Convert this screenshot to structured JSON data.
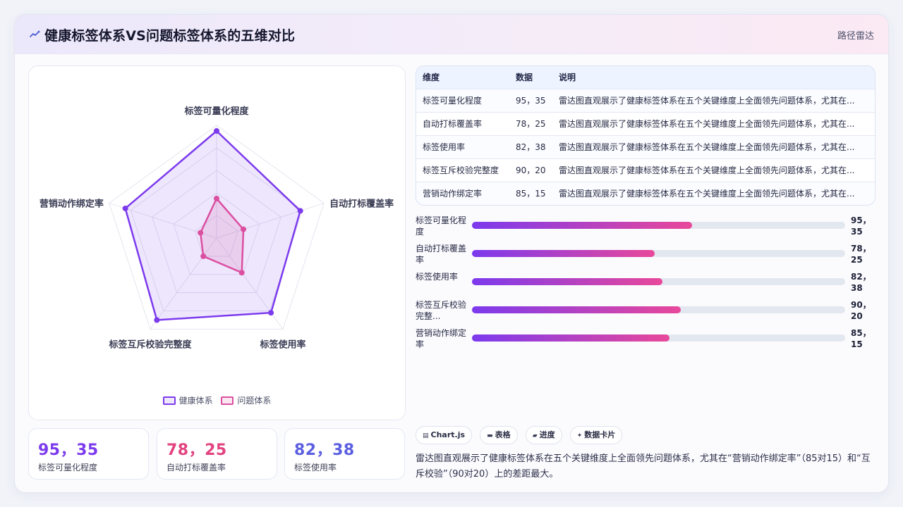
{
  "header": {
    "title": "健康标签体系VS问题标签体系的五维对比",
    "badge": "路径雷达"
  },
  "chart_data": {
    "type": "radar",
    "axes": [
      "标签可量化程度",
      "自动打标覆盖率",
      "标签使用率",
      "标签互斥校验完整度",
      "营销动作绑定率"
    ],
    "max": 100,
    "rings": 5,
    "series": [
      {
        "name": "健康体系",
        "values": [
          95,
          78,
          82,
          90,
          85
        ],
        "color": "#7c3aed"
      },
      {
        "name": "问题体系",
        "values": [
          35,
          25,
          38,
          20,
          15
        ],
        "color": "#db4fa0"
      }
    ]
  },
  "stats": [
    {
      "value": "95，35",
      "label": "标签可量化程度",
      "color": "#7c3aed"
    },
    {
      "value": "78，25",
      "label": "自动打标覆盖率",
      "color": "#e2427f"
    },
    {
      "value": "82，38",
      "label": "标签使用率",
      "color": "#5b5fe0"
    }
  ],
  "table": {
    "headers": [
      "维度",
      "数据",
      "说明"
    ],
    "rows": [
      [
        "标签可量化程度",
        "95，35",
        "雷达图直观展示了健康标签体系在五个关键维度上全面领先问题体系，尤其在..."
      ],
      [
        "自动打标覆盖率",
        "78，25",
        "雷达图直观展示了健康标签体系在五个关键维度上全面领先问题体系，尤其在..."
      ],
      [
        "标签使用率",
        "82，38",
        "雷达图直观展示了健康标签体系在五个关键维度上全面领先问题体系，尤其在..."
      ],
      [
        "标签互斥校验完整度",
        "90，20",
        "雷达图直观展示了健康标签体系在五个关键维度上全面领先问题体系，尤其在..."
      ],
      [
        "营销动作绑定率",
        "85，15",
        "雷达图直观展示了健康标签体系在五个关键维度上全面领先问题体系，尤其在..."
      ]
    ]
  },
  "bars": [
    {
      "label": "标签可量化程度",
      "value_text": "95，35",
      "level": 0.59
    },
    {
      "label": "自动打标覆盖率",
      "value_text": "78，25",
      "level": 0.49
    },
    {
      "label": "标签使用率",
      "value_text": "82，38",
      "level": 0.51
    },
    {
      "label": "标签互斥校验完整...",
      "value_text": "90，20",
      "level": 0.56
    },
    {
      "label": "营销动作绑定率",
      "value_text": "85，15",
      "level": 0.53
    }
  ],
  "chips": [
    {
      "icon": "chart-icon",
      "label": "Chart.js"
    },
    {
      "icon": "table-icon",
      "label": "表格"
    },
    {
      "icon": "progress-icon",
      "label": "进度"
    },
    {
      "icon": "card-icon",
      "label": "数据卡片"
    }
  ],
  "summary": "雷达图直观展示了健康标签体系在五个关键维度上全面领先问题体系，尤其在“营销动作绑定率”（85对15）和“互斥校验”（90对20）上的差距最大。"
}
